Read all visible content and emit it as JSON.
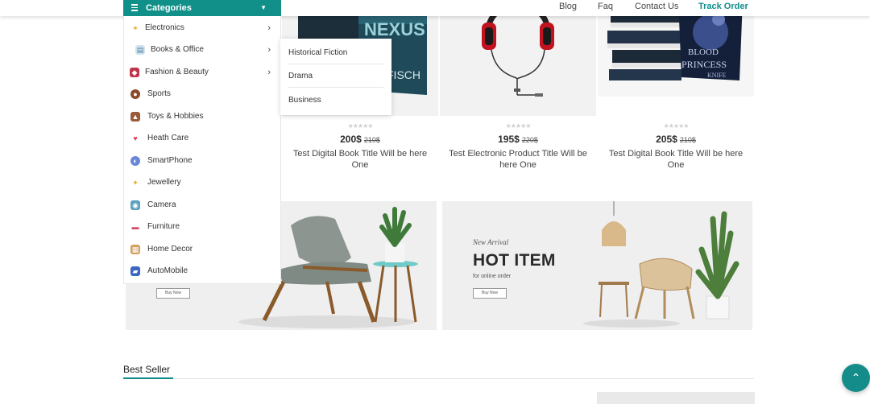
{
  "nav": {
    "categories_label": "Categories",
    "links": [
      {
        "label": "Blog"
      },
      {
        "label": "Faq"
      },
      {
        "label": "Contact Us"
      }
    ],
    "track_order": "Track Order"
  },
  "categories": [
    {
      "label": "Electronics",
      "icon": "electronics-icon",
      "has_sub": true
    },
    {
      "label": "Books & Office",
      "icon": "books-icon",
      "has_sub": true
    },
    {
      "label": "Fashion & Beauty",
      "icon": "fashion-icon",
      "has_sub": true
    },
    {
      "label": "Sports",
      "icon": "sports-icon",
      "has_sub": false
    },
    {
      "label": "Toys & Hobbies",
      "icon": "toys-icon",
      "has_sub": false
    },
    {
      "label": "Heath Care",
      "icon": "health-icon",
      "has_sub": false
    },
    {
      "label": "SmartPhone",
      "icon": "smartphone-icon",
      "has_sub": false
    },
    {
      "label": "Jewellery",
      "icon": "jewellery-icon",
      "has_sub": false
    },
    {
      "label": "Camera",
      "icon": "camera-icon",
      "has_sub": false
    },
    {
      "label": "Furniture",
      "icon": "furniture-icon",
      "has_sub": false
    },
    {
      "label": "Home Decor",
      "icon": "home-decor-icon",
      "has_sub": false
    },
    {
      "label": "AutoMobile",
      "icon": "automobile-icon",
      "has_sub": false
    }
  ],
  "submenu": [
    "Historical Fiction",
    "Drama",
    "Business"
  ],
  "products": [
    {
      "price": "200$",
      "old_price": "210$",
      "title": "Test Digital Book Title Will be here One",
      "rating": 0,
      "image": "book-nexus-image"
    },
    {
      "price": "195$",
      "old_price": "220$",
      "title": "Test Electronic Product Title Will be here One",
      "rating": 0,
      "image": "headphones-image"
    },
    {
      "price": "205$",
      "old_price": "210$",
      "title": "Test Digital Book Title Will be here One",
      "rating": 0,
      "image": "book-princess-image"
    }
  ],
  "banners": [
    {
      "button": "Buy Now"
    },
    {
      "kicker": "New Arrival",
      "title": "HOT ITEM",
      "subtitle": "for online order",
      "button": "Buy Now"
    }
  ],
  "best_seller": "Best Seller",
  "colors": {
    "accent": "#119089",
    "scroll_top": "#138c8a"
  }
}
